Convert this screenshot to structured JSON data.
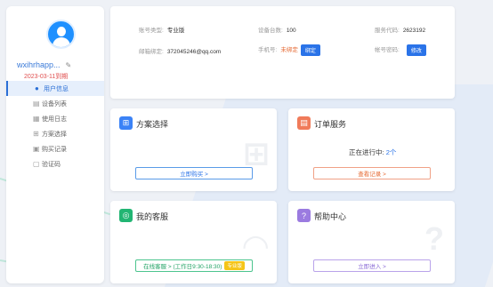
{
  "sidebar": {
    "username": "wxihrhapp...",
    "reg_date": "2023-03-11到期",
    "items": [
      {
        "label": "用户信息",
        "icon": "user-icon",
        "active": true
      },
      {
        "label": "设备列表",
        "icon": "device-list-icon",
        "active": false
      },
      {
        "label": "使用日志",
        "icon": "log-icon",
        "active": false
      },
      {
        "label": "方案选择",
        "icon": "cart-icon",
        "active": false
      },
      {
        "label": "购买记录",
        "icon": "purchase-record-icon",
        "active": false
      },
      {
        "label": "验证码",
        "icon": "verify-code-icon",
        "active": false
      }
    ]
  },
  "account": {
    "type_label": "账号类型:",
    "type_value": "专业版",
    "device_count_label": "设备台数:",
    "device_count_value": "100",
    "service_code_label": "服务代码:",
    "service_code_value": "2623192",
    "email_label": "邮箱绑定:",
    "email_value": "372045246@qq.com",
    "phone_label": "手机号:",
    "phone_value": "未绑定",
    "phone_button": "绑定",
    "password_label": "帐号密码:",
    "password_button": "修改"
  },
  "cards": {
    "plan": {
      "title": "方案选择",
      "button": "立即购买 >"
    },
    "order": {
      "title": "订单服务",
      "status_label": "正在进行中:",
      "status_value": "2个",
      "button": "查看记录 >"
    },
    "support": {
      "title": "我的客服",
      "button": "在线客服 > (工作日9:30-18:30)",
      "tag": "专业版"
    },
    "help": {
      "title": "帮助中心",
      "button": "立即进入 >"
    }
  },
  "colors": {
    "accent": "#2a73e8",
    "plan_icon": "#3b82f6",
    "order_icon": "#f07b5a",
    "support_icon": "#22b573",
    "help_icon": "#9b7be0"
  }
}
